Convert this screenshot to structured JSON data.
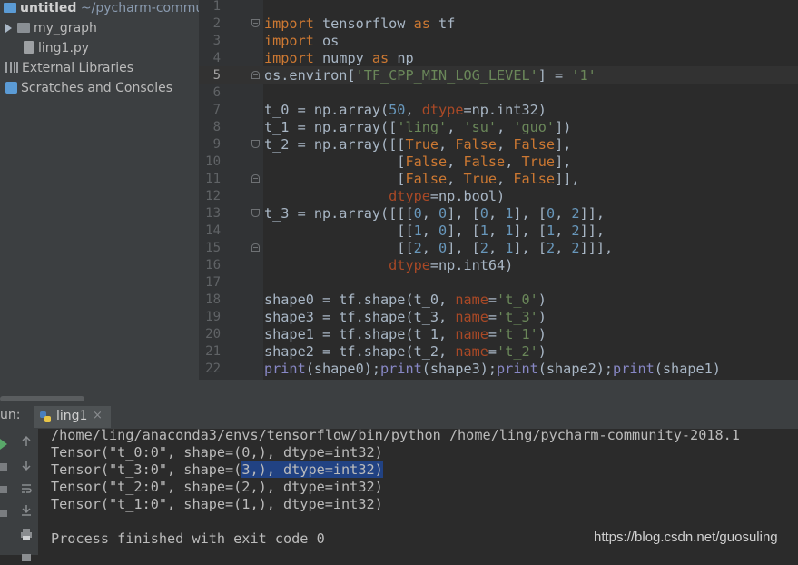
{
  "project": {
    "root_name": "untitled",
    "root_path": "~/pycharm-commun",
    "items": [
      {
        "label": "my_graph"
      },
      {
        "label": "ling1.py"
      },
      {
        "label": "External Libraries"
      },
      {
        "label": "Scratches and Consoles"
      }
    ]
  },
  "editor": {
    "line_numbers": [
      "1",
      "2",
      "3",
      "4",
      "5",
      "6",
      "7",
      "8",
      "9",
      "10",
      "11",
      "12",
      "13",
      "14",
      "15",
      "16",
      "17",
      "18",
      "19",
      "20",
      "21",
      "22"
    ],
    "current_line": "5"
  },
  "run": {
    "label": "un:",
    "tab_label": "ling1",
    "output": [
      "/home/ling/anaconda3/envs/tensorflow/bin/python /home/ling/pycharm-community-2018.1",
      "Tensor(\"t_0:0\", shape=(0,), dtype=int32)",
      "Tensor(\"t_3:0\", shape=(",
      "3,), dtype=int32)",
      "Tensor(\"t_2:0\", shape=(2,), dtype=int32)",
      "Tensor(\"t_1:0\", shape=(1,), dtype=int32)",
      "",
      "Process finished with exit code 0"
    ]
  },
  "watermark": "https://blog.csdn.net/guosuling"
}
